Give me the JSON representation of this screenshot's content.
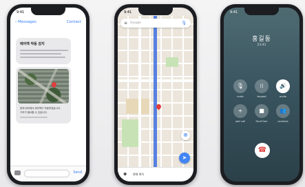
{
  "phone1": {
    "status_time": "9:41",
    "back_label": "Messages",
    "contact_label": "Contact",
    "bubble_title": "에어백 작동 감지",
    "caption_line1": "현재 위치에서 에어백이 작동하였습니다.",
    "caption_line2": "구조가 필요할 수 있습니다.",
    "send_label": "Send"
  },
  "phone2": {
    "status_time": "9:41",
    "menu_icon": "≡",
    "search_placeholder": "Google",
    "mic_icon": "🎙",
    "compass_icon": "⊕",
    "fab_icon": "➤",
    "bottom_label": "현재 위치"
  },
  "phone3": {
    "status_time": "9:41",
    "caller_name": "홍길동",
    "duration": "23:41",
    "buttons": [
      {
        "label": "mute",
        "icon": "🎙"
      },
      {
        "label": "keypad",
        "icon": "⁞⁞"
      },
      {
        "label": "audio",
        "icon": "🔊"
      },
      {
        "label": "add call",
        "icon": "+"
      },
      {
        "label": "FaceTime",
        "icon": "■"
      },
      {
        "label": "contacts",
        "icon": "👥"
      }
    ],
    "end_call_icon": "☎"
  }
}
